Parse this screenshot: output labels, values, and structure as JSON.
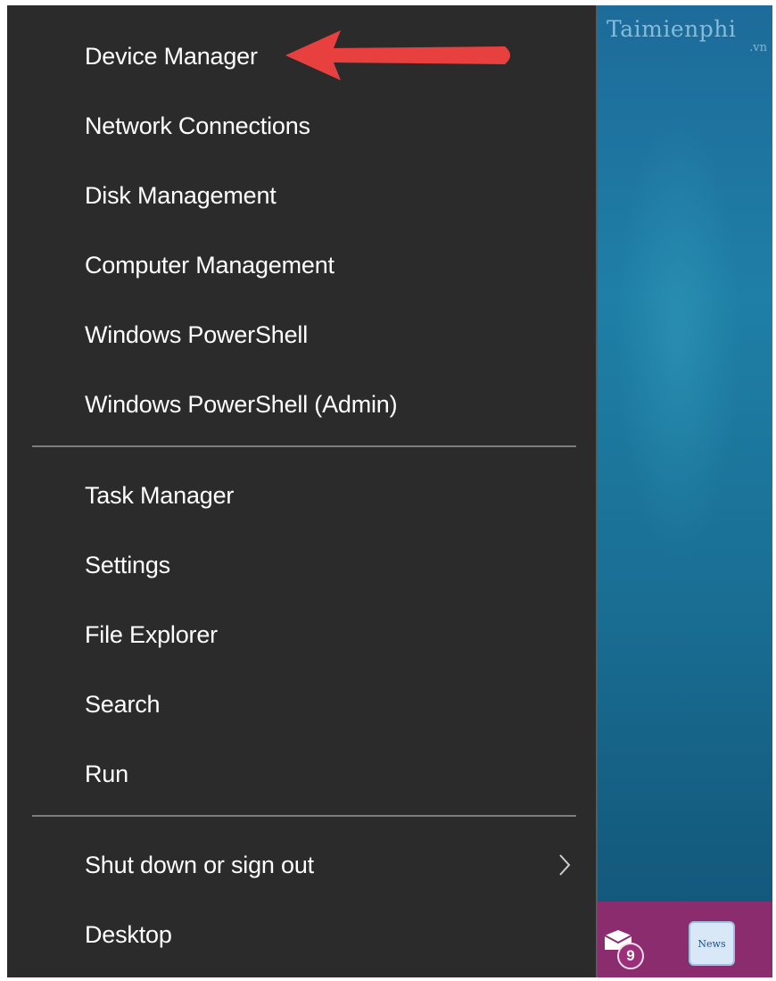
{
  "menu": {
    "items": [
      {
        "label": "Device Manager"
      },
      {
        "label": "Network Connections"
      },
      {
        "label": "Disk Management"
      },
      {
        "label": "Computer Management"
      },
      {
        "label": "Windows PowerShell"
      },
      {
        "label": "Windows PowerShell (Admin)"
      },
      {
        "label": "Task Manager"
      },
      {
        "label": "Settings"
      },
      {
        "label": "File Explorer"
      },
      {
        "label": "Search"
      },
      {
        "label": "Run"
      },
      {
        "label": "Shut down or sign out"
      },
      {
        "label": "Desktop"
      }
    ]
  },
  "watermark": {
    "text": "Taimienphi",
    "sub": ".vn"
  },
  "taskbar": {
    "mail_badge": "9",
    "news_label": "News"
  },
  "colors": {
    "menu_bg": "#2b2b2b",
    "arrow": "#e8403f",
    "taskbar": "#8a2c6e"
  },
  "icons": [
    "chevron-right-icon",
    "mail-icon",
    "news-icon",
    "red-arrow-annotation"
  ]
}
